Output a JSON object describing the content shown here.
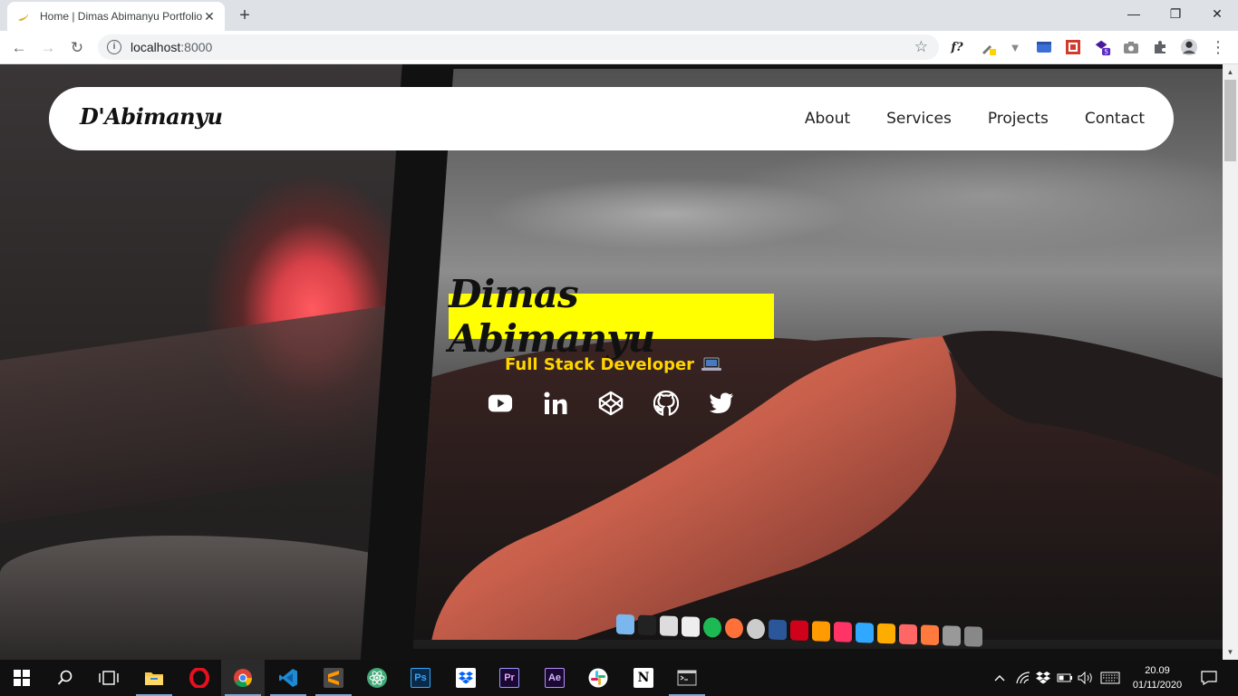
{
  "browser": {
    "tab_title": "Home | Dimas Abimanyu Portfolio",
    "tab_close": "✕",
    "new_tab": "+",
    "url_host": "localhost",
    "url_port": ":8000",
    "window_minimize": "—",
    "window_restore": "❐",
    "window_close": "✕",
    "nav_back": "←",
    "nav_forward": "→",
    "nav_reload": "↻",
    "bookmark_star": "☆",
    "menu": "⋮",
    "extensions": [
      {
        "name": "fontface-ninja",
        "label": "f?"
      },
      {
        "name": "color-picker",
        "label": "✎"
      },
      {
        "name": "vue-devtools",
        "label": "▼"
      },
      {
        "name": "window-resizer",
        "label": "▬"
      },
      {
        "name": "page-ruler",
        "label": "▦"
      },
      {
        "name": "extension-badge",
        "label": "5"
      },
      {
        "name": "screenshot",
        "label": "📷"
      },
      {
        "name": "puzzle",
        "label": "✱"
      }
    ]
  },
  "page": {
    "brand": "D'Abimanyu",
    "nav": [
      "About",
      "Services",
      "Projects",
      "Contact"
    ],
    "hero_name": "Dimas Abimanyu",
    "hero_role": "Full Stack Developer",
    "socials": [
      "youtube",
      "linkedin",
      "codepen",
      "github",
      "twitter"
    ]
  },
  "taskbar": {
    "apps": [
      "start",
      "search",
      "task-view",
      "file-explorer",
      "opera",
      "chrome",
      "vscode",
      "sublime-text",
      "atom",
      "photoshop",
      "dropbox",
      "premiere-pro",
      "after-effects",
      "slack",
      "notion",
      "terminal"
    ],
    "app_labels": {
      "photoshop": "Ps",
      "premiere": "Pr",
      "after_effects": "Ae",
      "notion": "N"
    },
    "time": "20.09",
    "date": "01/11/2020"
  },
  "colors": {
    "accent_yellow": "#ffff00",
    "role_yellow": "#ffd400",
    "nav_bg": "#ffffff"
  }
}
